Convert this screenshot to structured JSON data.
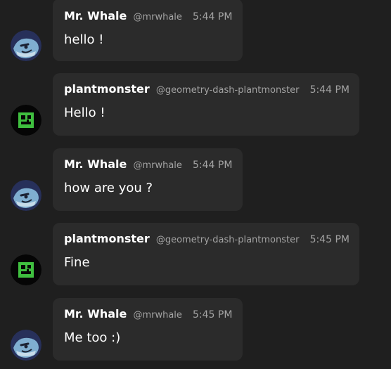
{
  "messages": [
    {
      "author": "Mr. Whale",
      "handle": "@mrwhale",
      "time": "5:44 PM",
      "text": "hello !",
      "avatar": "whale-avatar"
    },
    {
      "author": "plantmonster",
      "handle": "@geometry-dash-plantmonster",
      "time": "5:44 PM",
      "text": "Hello !",
      "avatar": "plantmonster-avatar"
    },
    {
      "author": "Mr. Whale",
      "handle": "@mrwhale",
      "time": "5:44 PM",
      "text": "how are you ?",
      "avatar": "whale-avatar"
    },
    {
      "author": "plantmonster",
      "handle": "@geometry-dash-plantmonster",
      "time": "5:45 PM",
      "text": "Fine",
      "avatar": "plantmonster-avatar"
    },
    {
      "author": "Mr. Whale",
      "handle": "@mrwhale",
      "time": "5:45 PM",
      "text": "Me too :)",
      "avatar": "whale-avatar"
    }
  ],
  "colors": {
    "background": "#1f1f1f",
    "bubble": "#2b2b2b",
    "text": "#ffffff",
    "muted": "#a3a3a3"
  }
}
